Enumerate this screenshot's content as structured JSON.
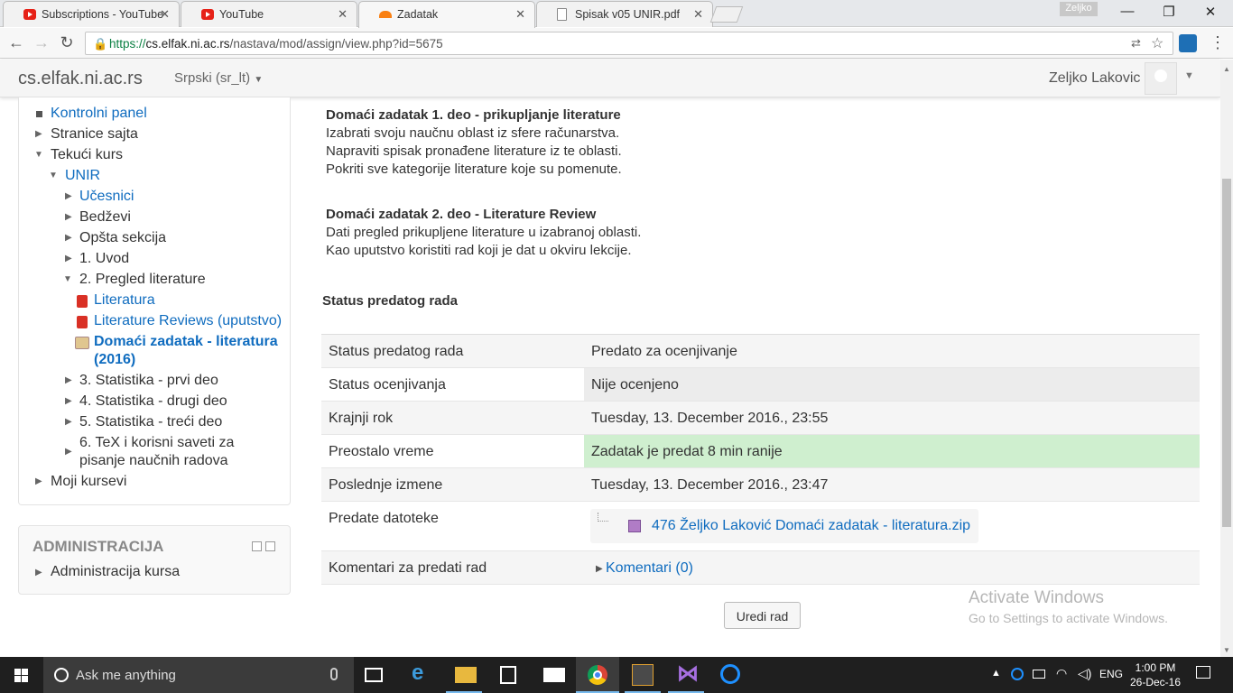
{
  "browser": {
    "tabs": [
      {
        "title": "Subscriptions - YouTube",
        "icon": "youtube-icon",
        "active": false
      },
      {
        "title": "YouTube",
        "icon": "youtube-icon",
        "active": false
      },
      {
        "title": "Zadatak",
        "icon": "moodle-icon",
        "active": true
      },
      {
        "title": "Spisak v05 UNIR.pdf",
        "icon": "document-icon",
        "active": false
      }
    ],
    "profile_chip": "Zeljko",
    "url_scheme": "https://",
    "url_host": "cs.elfak.ni.ac.rs",
    "url_path": "/nastava/mod/assign/view.php?id=5675"
  },
  "moodle": {
    "brand": "cs.elfak.ni.ac.rs",
    "language": "Srpski (sr_lt)",
    "user_name": "Zeljko Lakovic"
  },
  "navigation": {
    "items": [
      {
        "label": "Kontrolni panel"
      },
      {
        "label": "Stranice sajta"
      },
      {
        "label": "Tekući kurs"
      },
      {
        "label": "UNIR"
      },
      {
        "label": "Učesnici"
      },
      {
        "label": "Bedževi"
      },
      {
        "label": "Opšta sekcija"
      },
      {
        "label": "1. Uvod"
      },
      {
        "label": "2. Pregled literature"
      },
      {
        "label": "Literatura"
      },
      {
        "label": "Literature Reviews (uputstvo)"
      },
      {
        "label": "Domaći zadatak - literatura"
      },
      {
        "label": "(2016)"
      },
      {
        "label": "3. Statistika - prvi deo"
      },
      {
        "label": "4. Statistika - drugi deo"
      },
      {
        "label": "5. Statistika - treći deo"
      },
      {
        "label": "6. TeX i korisni saveti za"
      },
      {
        "label": "pisanje naučnih radova"
      },
      {
        "label": "Moji kursevi"
      }
    ]
  },
  "administration": {
    "title": "ADMINISTRACIJA",
    "item": "Administracija kursa"
  },
  "description": {
    "part1_title": "Domaći zadatak 1. deo - prikupljanje literature",
    "part1_lines": [
      "Izabrati svoju naučnu oblast iz sfere računarstva.",
      "Napraviti spisak pronađene literature iz te oblasti.",
      "Pokriti sve kategorije literature koje su pomenute."
    ],
    "part2_title": "Domaći zadatak 2. deo - Literature Review",
    "part2_lines": [
      "Dati pregled prikupljene literature u izabranoj oblasti.",
      "Kao uputstvo koristiti rad koji je dat u okviru lekcije."
    ]
  },
  "status": {
    "heading": "Status predatog rada",
    "rows": [
      {
        "label": "Status predatog rada",
        "value": "Predato za ocenjivanje"
      },
      {
        "label": "Status ocenjivanja",
        "value": "Nije ocenjeno"
      },
      {
        "label": "Krajnji rok",
        "value": "Tuesday, 13. December 2016., 23:55"
      },
      {
        "label": "Preostalo vreme",
        "value": "Zadatak je predat 8 min ranije"
      },
      {
        "label": "Poslednje izmene",
        "value": "Tuesday, 13. December 2016., 23:47"
      },
      {
        "label": "Predate datoteke",
        "value": "476 Željko Laković Domaći zadatak - literatura.zip"
      },
      {
        "label": "Komentari za predati rad",
        "value": "Komentari (0)"
      }
    ],
    "edit_button": "Uredi rad"
  },
  "watermark": {
    "line1": "Activate Windows",
    "line2": "Go to Settings to activate Windows."
  },
  "taskbar": {
    "search_placeholder": "Ask me anything",
    "language": "ENG",
    "time": "1:00 PM",
    "date": "26-Dec-16"
  },
  "colors": {
    "link": "#0f6cbf",
    "status_green": "#cfefcf",
    "taskbar": "#1f1f1f"
  }
}
